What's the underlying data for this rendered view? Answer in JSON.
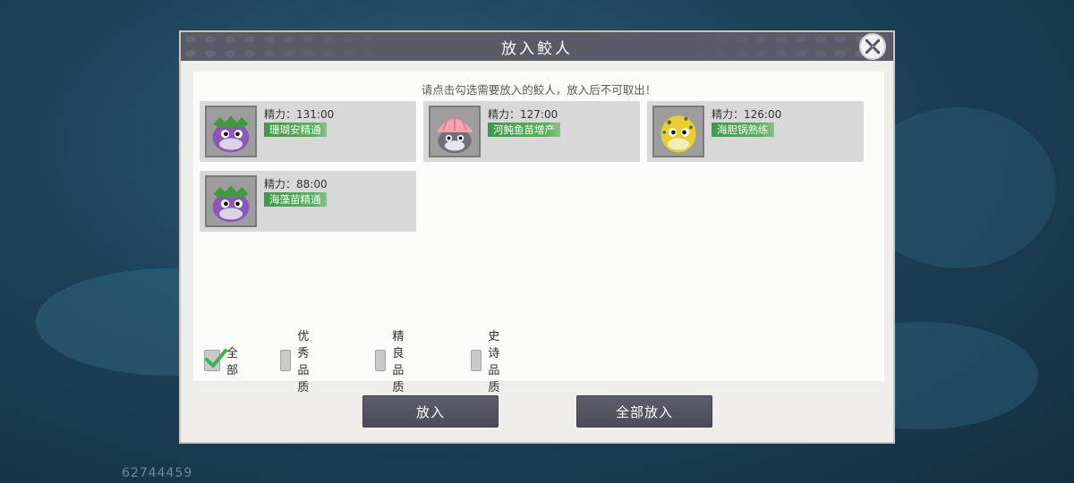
{
  "dialog": {
    "title": "放入鲛人",
    "hint": "请点击勾选需要放入的鲛人，放入后不可取出！",
    "close_icon": "close-x-icon"
  },
  "mermen": [
    {
      "stamina": "精力：131:00",
      "skill": "珊瑚安精通",
      "portrait": "purple-fish-with-leaf-crown",
      "color": "#8e56b8"
    },
    {
      "stamina": "精力：127:00",
      "skill": "河鲀鱼苗增产",
      "portrait": "grey-fish-with-pink-shell-hat",
      "color": "#6f7079"
    },
    {
      "stamina": "精力：126:00",
      "skill": "海胆锅熟练",
      "portrait": "yellow-spotted-fish",
      "color": "#e7cf2f"
    },
    {
      "stamina": "精力：88:00",
      "skill": "海藻苗精通",
      "portrait": "purple-fish-with-leaf-crown",
      "color": "#8e56b8"
    }
  ],
  "filters": [
    {
      "label": "全部",
      "checked": true
    },
    {
      "label": "优秀品质",
      "checked": false
    },
    {
      "label": "精良品质",
      "checked": false
    },
    {
      "label": "史诗品质",
      "checked": false
    }
  ],
  "buttons": {
    "place": "放入",
    "place_all": "全部放入"
  },
  "footer": {
    "uid": "62744459"
  },
  "colors": {
    "title_bar": "#5b5a68",
    "skill_tag": "#56b25c",
    "check_mark": "#3bb24a"
  }
}
